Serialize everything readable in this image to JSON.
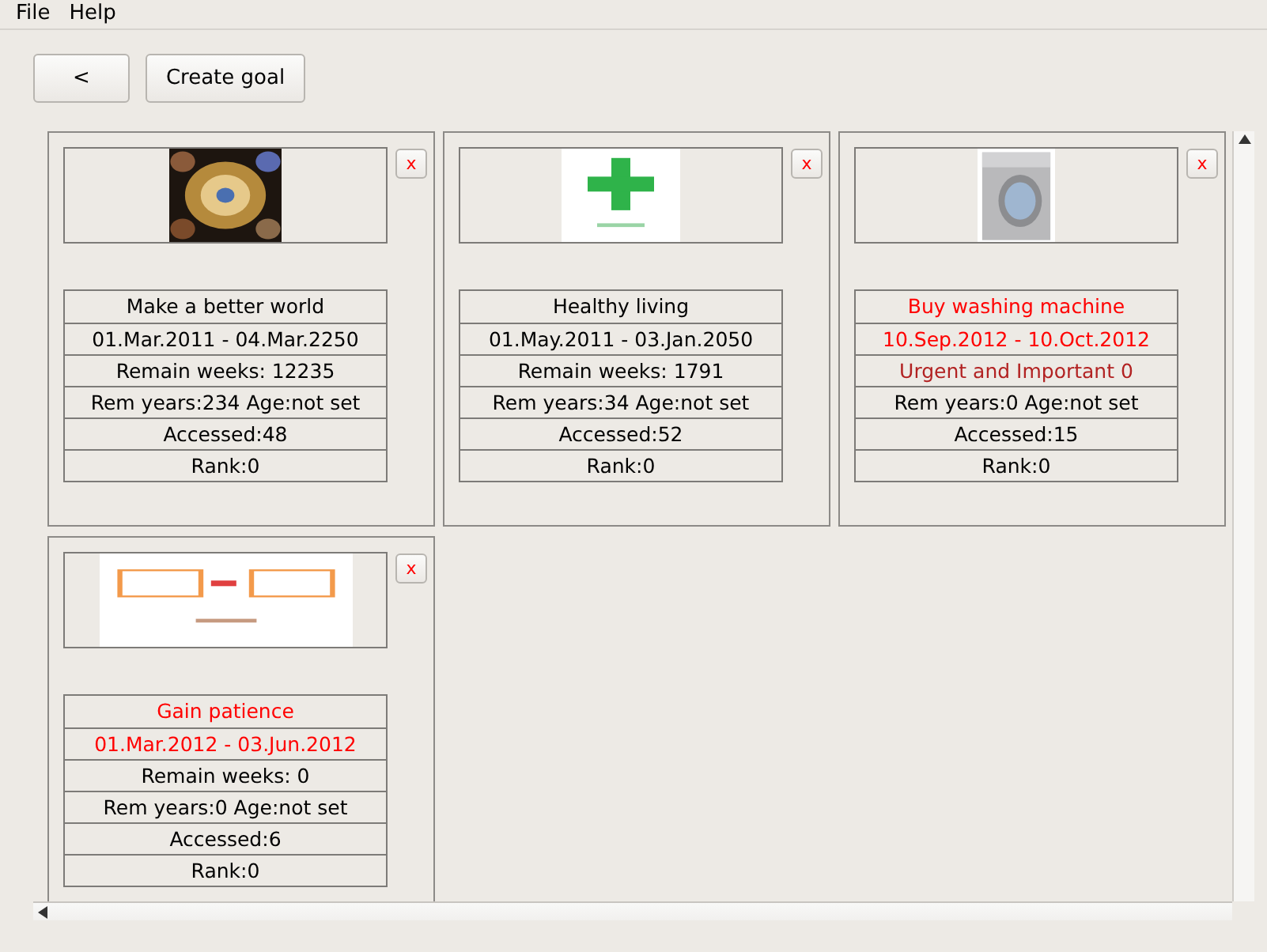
{
  "menu": [
    "File",
    "Help"
  ],
  "toolbar": {
    "back": "<",
    "create": "Create goal"
  },
  "goals": [
    {
      "kind": "picture",
      "close": "x",
      "rows": [
        {
          "text": "Make a better world",
          "color": "#000000"
        },
        {
          "text": "01.Mar.2011 - 04.Mar.2250",
          "color": "#000000"
        },
        {
          "text": "Remain weeks: 12235",
          "color": "#000000"
        },
        {
          "text": "Rem years:234 Age:not set",
          "color": "#000000"
        },
        {
          "text": "Accessed:48",
          "color": "#000000"
        },
        {
          "text": "Rank:0",
          "color": "#000000"
        }
      ]
    },
    {
      "kind": "picture",
      "close": "x",
      "rows": [
        {
          "text": "Healthy living",
          "color": "#000000"
        },
        {
          "text": "01.May.2011 - 03.Jan.2050",
          "color": "#000000"
        },
        {
          "text": "Remain weeks: 1791",
          "color": "#000000"
        },
        {
          "text": "Rem years:34 Age:not set",
          "color": "#000000"
        },
        {
          "text": "Accessed:52",
          "color": "#000000"
        },
        {
          "text": "Rank:0",
          "color": "#000000"
        }
      ]
    },
    {
      "kind": "picture",
      "close": "x",
      "rows": [
        {
          "text": "Buy washing machine",
          "color": "#ff0000"
        },
        {
          "text": "10.Sep.2012 - 10.Oct.2012",
          "color": "#ff0000"
        },
        {
          "text": "Urgent and Important 0",
          "color": "#b22222"
        },
        {
          "text": "Rem years:0 Age:not set",
          "color": "#000000"
        },
        {
          "text": "Accessed:15",
          "color": "#000000"
        },
        {
          "text": "Rank:0",
          "color": "#000000"
        }
      ]
    },
    {
      "kind": "picture",
      "close": "x",
      "rows": [
        {
          "text": "Gain patience",
          "color": "#ff0000"
        },
        {
          "text": "01.Mar.2012 - 03.Jun.2012",
          "color": "#ff0000"
        },
        {
          "text": "Remain weeks: 0",
          "color": "#000000"
        },
        {
          "text": "Rem years:0 Age:not set",
          "color": "#000000"
        },
        {
          "text": "Accessed:6",
          "color": "#000000"
        },
        {
          "text": "Rank:0",
          "color": "#000000"
        }
      ]
    }
  ]
}
